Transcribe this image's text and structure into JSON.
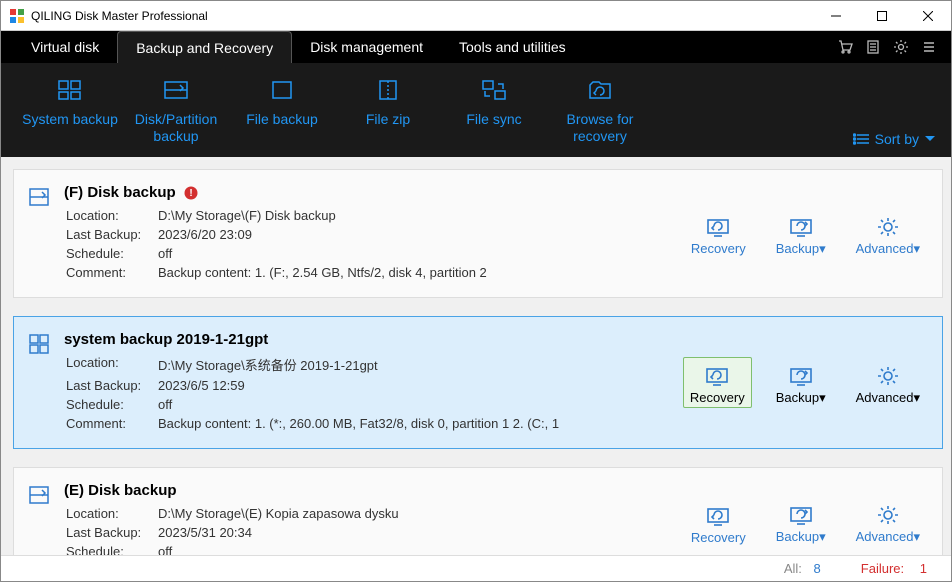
{
  "window": {
    "title": "QILING Disk Master Professional"
  },
  "tabs": [
    "Virtual disk",
    "Backup and Recovery",
    "Disk management",
    "Tools and utilities"
  ],
  "active_tab": 1,
  "toolbar": [
    {
      "icon": "system-backup-icon",
      "label": "System backup"
    },
    {
      "icon": "partition-backup-icon",
      "label": "Disk/Partition backup"
    },
    {
      "icon": "file-backup-icon",
      "label": "File backup"
    },
    {
      "icon": "file-zip-icon",
      "label": "File zip"
    },
    {
      "icon": "file-sync-icon",
      "label": "File sync"
    },
    {
      "icon": "browse-recovery-icon",
      "label": "Browse for recovery"
    }
  ],
  "sort_label": "Sort by",
  "field_labels": {
    "location": "Location:",
    "last_backup": "Last Backup:",
    "schedule": "Schedule:",
    "comment": "Comment:"
  },
  "action_labels": {
    "recovery": "Recovery",
    "backup": "Backup▾",
    "advanced": "Advanced▾"
  },
  "items": [
    {
      "name": "(F) Disk backup",
      "has_error": true,
      "selected": false,
      "icon": "disk-icon",
      "location": "D:\\My Storage\\(F) Disk backup",
      "last_backup": "2023/6/20 23:09",
      "schedule": "off",
      "comment": "Backup content:  1. (F:, 2.54 GB, Ntfs/2, disk 4, partition 2"
    },
    {
      "name": "system backup 2019-1-21gpt",
      "has_error": false,
      "selected": true,
      "icon": "system-icon",
      "location": "D:\\My Storage\\系统备份 2019-1-21gpt",
      "last_backup": "2023/6/5 12:59",
      "schedule": "off",
      "comment": "Backup content:  1. (*:, 260.00 MB, Fat32/8, disk 0, partition 1   2. (C:, 1"
    },
    {
      "name": "(E) Disk backup",
      "has_error": false,
      "selected": false,
      "icon": "disk-icon",
      "location": "D:\\My Storage\\(E) Kopia zapasowa dysku",
      "last_backup": "2023/5/31 20:34",
      "schedule": "off",
      "comment": ""
    }
  ],
  "status": {
    "all_label": "All:",
    "all_value": "8",
    "failure_label": "Failure:",
    "failure_value": "1"
  }
}
